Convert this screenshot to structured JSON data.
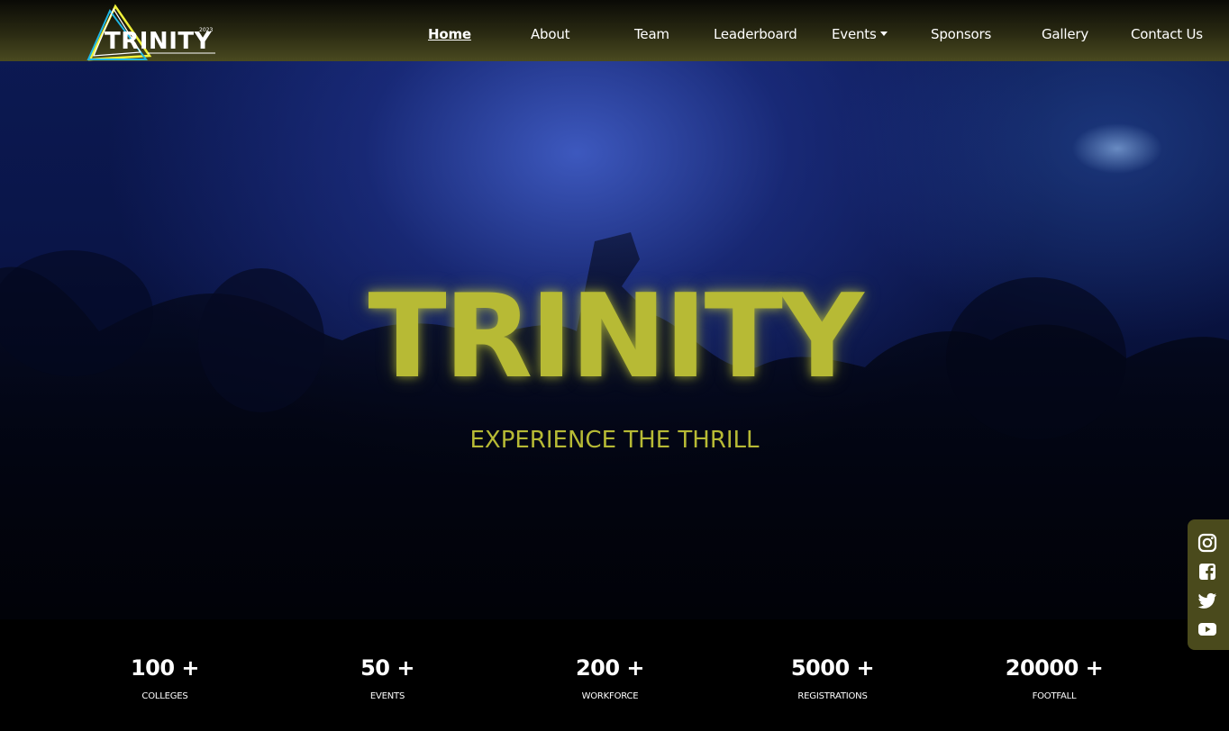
{
  "navbar": {
    "logo": {
      "text": "TRINITY",
      "year": "2023",
      "colors": [
        "#f1f23a",
        "#1fb7e6",
        "#ffffff"
      ]
    },
    "links": [
      {
        "label": "Home",
        "active": true
      },
      {
        "label": "About"
      },
      {
        "label": "Team"
      },
      {
        "label": "Leaderboard"
      },
      {
        "label": "Events",
        "dropdown": true
      },
      {
        "label": "Sponsors"
      },
      {
        "label": "Gallery"
      },
      {
        "label": "Contact Us"
      }
    ]
  },
  "hero": {
    "title": "TRINITY",
    "subtitle": "EXPERIENCE THE THRILL",
    "accent_color": "#b7ba35"
  },
  "social": {
    "icons": [
      "instagram-icon",
      "facebook-icon",
      "twitter-icon",
      "youtube-icon"
    ],
    "bg_color": "#4a4a1c"
  },
  "stats": [
    {
      "value": "100 +",
      "label": "COLLEGES"
    },
    {
      "value": "50 +",
      "label": "EVENTS"
    },
    {
      "value": "200 +",
      "label": "WORKFORCE"
    },
    {
      "value": "5000 +",
      "label": "REGISTRATIONS"
    },
    {
      "value": "20000 +",
      "label": "FOOTFALL"
    }
  ]
}
